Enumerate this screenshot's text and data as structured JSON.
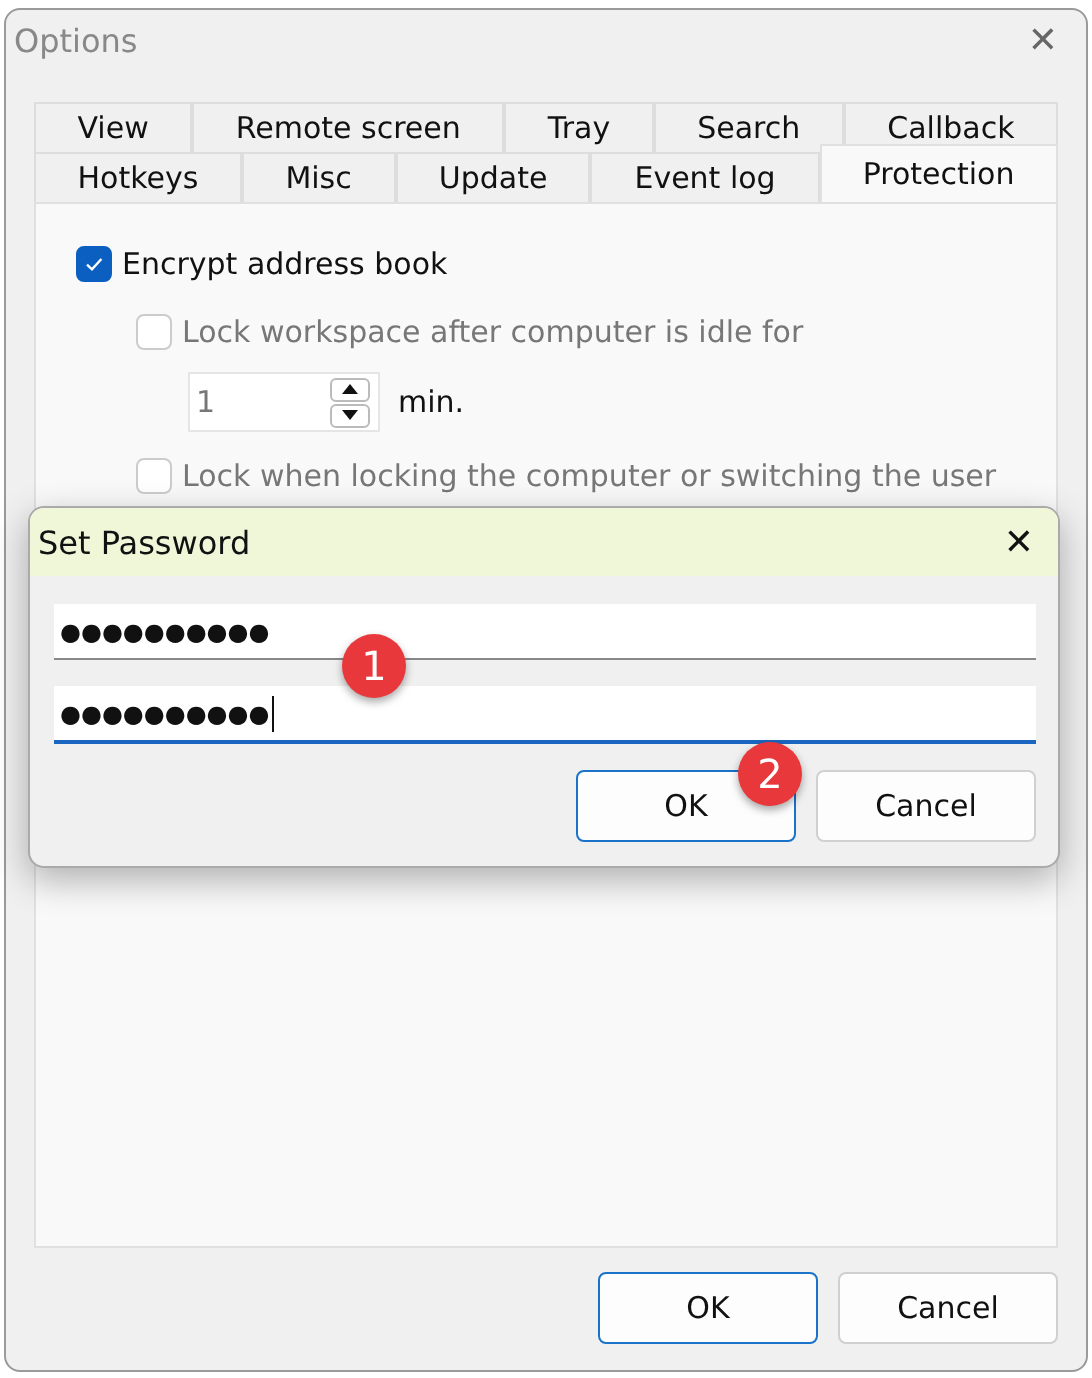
{
  "window": {
    "title": "Options",
    "close": "✕"
  },
  "tab_rows": [
    [
      {
        "label": "View",
        "selected": false
      },
      {
        "label": "Remote screen",
        "selected": false
      },
      {
        "label": "Tray",
        "selected": false
      },
      {
        "label": "Search",
        "selected": false
      },
      {
        "label": "Callback",
        "selected": false
      }
    ],
    [
      {
        "label": "Hotkeys",
        "selected": false
      },
      {
        "label": "Misc",
        "selected": false
      },
      {
        "label": "Update",
        "selected": false
      },
      {
        "label": "Event log",
        "selected": false
      },
      {
        "label": "Protection",
        "selected": true
      }
    ]
  ],
  "options": [
    {
      "label": "Encrypt address book",
      "checked": true,
      "disabled": false
    },
    {
      "label": "Lock workspace after computer is idle for",
      "checked": false,
      "disabled": true
    },
    {
      "label": "Lock when locking the computer or switching the user",
      "checked": false,
      "disabled": true
    }
  ],
  "idle": {
    "value": "1",
    "unit": "min."
  },
  "dialog": {
    "title": "Set Password",
    "close": "✕",
    "fields": [
      {
        "value": "●●●●●●●●●●",
        "focused": false
      },
      {
        "value": "●●●●●●●●●●",
        "focused": true
      }
    ],
    "buttons": [
      {
        "label": "OK",
        "default": true
      },
      {
        "label": "Cancel",
        "default": false
      }
    ]
  },
  "markers": [
    "1",
    "2"
  ],
  "buttons": [
    {
      "label": "OK",
      "default": true
    },
    {
      "label": "Cancel",
      "default": false
    }
  ]
}
